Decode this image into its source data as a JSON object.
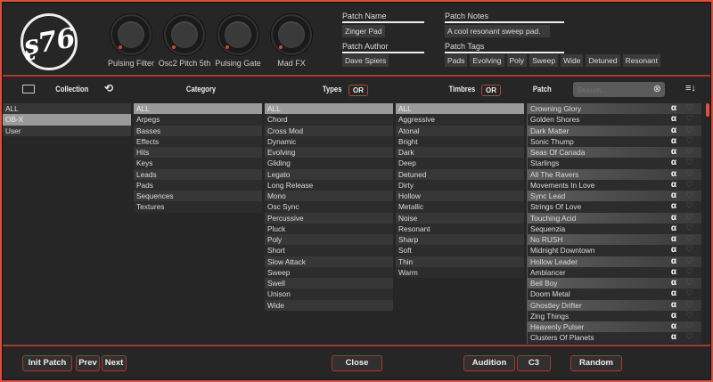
{
  "logo": "S76",
  "knobs": [
    "Pulsing Filter",
    "Osc2 Pitch 5th",
    "Pulsing Gate",
    "Mad FX"
  ],
  "patch_name": {
    "label": "Patch Name",
    "value": "Zinger Pad"
  },
  "patch_author": {
    "label": "Patch Author",
    "value": "Dave Spiers"
  },
  "patch_notes": {
    "label": "Patch Notes",
    "value": "A cool resonant sweep pad."
  },
  "patch_tags": {
    "label": "Patch Tags",
    "tags": [
      "Pads",
      "Evolving",
      "Poly",
      "Sweep",
      "Wide",
      "Detuned",
      "Resonant"
    ]
  },
  "headers": {
    "collection": "Collection",
    "category": "Category",
    "types": "Types",
    "types_or": "OR",
    "timbres": "Timbres",
    "timbres_or": "OR",
    "patch": "Patch",
    "search_placeholder": "Search..."
  },
  "collection": [
    "ALL",
    "OB-X",
    "User"
  ],
  "collection_selected": 1,
  "category": [
    "ALL",
    "Arpegs",
    "Basses",
    "Effects",
    "Hits",
    "Keys",
    "Leads",
    "Pads",
    "Sequences",
    "Textures"
  ],
  "types": [
    "ALL",
    "Chord",
    "Cross Mod",
    "Dynamic",
    "Evolving",
    "Gliding",
    "Legato",
    "Long Release",
    "Mono",
    "Osc Sync",
    "Percussive",
    "Pluck",
    "Poly",
    "Short",
    "Slow Attack",
    "Sweep",
    "Swell",
    "Unison",
    "Wide"
  ],
  "timbres": [
    "ALL",
    "Aggressive",
    "Atonal",
    "Bright",
    "Dark",
    "Deep",
    "Detuned",
    "Dirty",
    "Hollow",
    "Metallic",
    "Noise",
    "Resonant",
    "Sharp",
    "Soft",
    "Thin",
    "Warm"
  ],
  "patches": [
    "Crowning Glory",
    "Golden Shores",
    "Dark Matter",
    "Sonic Thump",
    "Seas Of Canada",
    "Starlings",
    "All The Ravers",
    "Movements In Love",
    "Sync Lead",
    "Strings Of Love",
    "Touching Acid",
    "Sequenzia",
    "No RUSH",
    "Midnight Downtown",
    "Hollow Leader",
    "Amblancer",
    "Bell Boy",
    "Doom Metal",
    "Ghostley Drifter",
    "Zing Things",
    "Heavenly Pulser",
    "Clusters Of Planets"
  ],
  "buttons": {
    "init": "Init Patch",
    "prev": "Prev",
    "next": "Next",
    "close": "Close",
    "audition": "Audition",
    "note": "C3",
    "random": "Random"
  },
  "colors": {
    "accent": "#d9503f",
    "bg": "#262626"
  }
}
